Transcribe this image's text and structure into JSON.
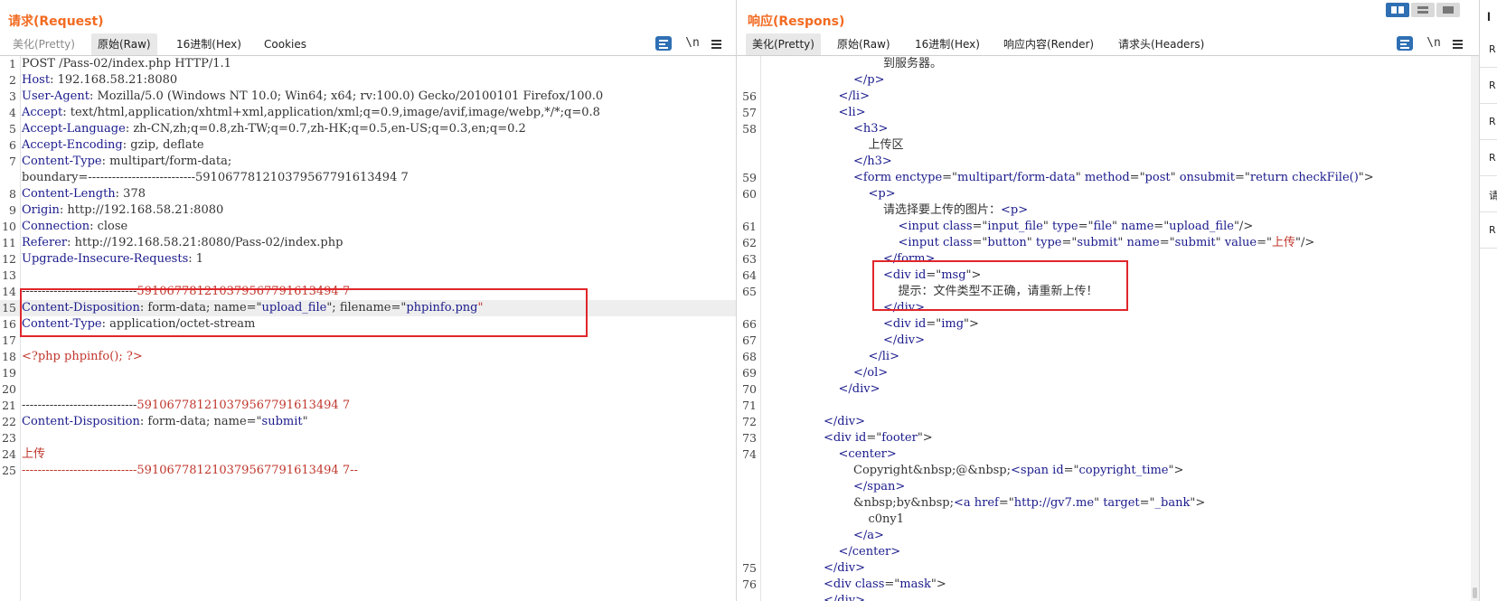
{
  "request": {
    "title": "请求(Request)",
    "tabs": [
      {
        "label": "美化(Pretty)",
        "state": "dim"
      },
      {
        "label": "原始(Raw)",
        "state": "active"
      },
      {
        "label": "16进制(Hex)",
        "state": "normal"
      },
      {
        "label": "Cookies",
        "state": "normal"
      }
    ],
    "tools": {
      "newline": "\\n"
    },
    "lines": [
      {
        "n": "1",
        "parts": [
          [
            "v",
            "POST /Pass-02/index.php HTTP/1.1"
          ]
        ]
      },
      {
        "n": "2",
        "parts": [
          [
            "k",
            "Host"
          ],
          [
            "v",
            ": 192.168.58.21:8080"
          ]
        ]
      },
      {
        "n": "3",
        "parts": [
          [
            "k",
            "User-Agent"
          ],
          [
            "v",
            ": Mozilla/5.0 (Windows NT 10.0; Win64; x64; rv:100.0) Gecko/20100101 Firefox/100.0"
          ]
        ]
      },
      {
        "n": "4",
        "parts": [
          [
            "k",
            "Accept"
          ],
          [
            "v",
            ": text/html,application/xhtml+xml,application/xml;q=0.9,image/avif,image/webp,*/*;q=0.8"
          ]
        ]
      },
      {
        "n": "5",
        "parts": [
          [
            "k",
            "Accept-Language"
          ],
          [
            "v",
            ": zh-CN,zh;q=0.8,zh-TW;q=0.7,zh-HK;q=0.5,en-US;q=0.3,en;q=0.2"
          ]
        ]
      },
      {
        "n": "6",
        "parts": [
          [
            "k",
            "Accept-Encoding"
          ],
          [
            "v",
            ": gzip, deflate"
          ]
        ]
      },
      {
        "n": "7",
        "parts": [
          [
            "k",
            "Content-Type"
          ],
          [
            "v",
            ": multipart/form-data;"
          ]
        ]
      },
      {
        "n": "",
        "parts": [
          [
            "v",
            "boundary=---------------------------591067781210379567791613494 7"
          ]
        ]
      },
      {
        "n": "8",
        "parts": [
          [
            "k",
            "Content-Length"
          ],
          [
            "v",
            ": 378"
          ]
        ]
      },
      {
        "n": "9",
        "parts": [
          [
            "k",
            "Origin"
          ],
          [
            "v",
            ": http://192.168.58.21:8080"
          ]
        ]
      },
      {
        "n": "10",
        "parts": [
          [
            "k",
            "Connection"
          ],
          [
            "v",
            ": close"
          ]
        ]
      },
      {
        "n": "11",
        "parts": [
          [
            "k",
            "Referer"
          ],
          [
            "v",
            ": http://192.168.58.21:8080/Pass-02/index.php"
          ]
        ]
      },
      {
        "n": "12",
        "parts": [
          [
            "k",
            "Upgrade-Insecure-Requests"
          ],
          [
            "v",
            ": 1"
          ]
        ]
      },
      {
        "n": "13",
        "parts": []
      },
      {
        "n": "14",
        "parts": [
          [
            "v",
            "-----------------------------"
          ],
          [
            "r",
            "591067781210379567791613494 7"
          ]
        ]
      },
      {
        "n": "15",
        "parts": [
          [
            "k",
            "Content-Disposition"
          ],
          [
            "v",
            ": form-data; name=\""
          ],
          [
            "s",
            "upload_file"
          ],
          [
            "v",
            "\"; filename=\""
          ],
          [
            "s",
            "phpinfo.png"
          ],
          [
            "r",
            "\""
          ]
        ],
        "hl": true
      },
      {
        "n": "16",
        "parts": [
          [
            "k",
            "Content-Type"
          ],
          [
            "v",
            ": application/octet-stream"
          ]
        ]
      },
      {
        "n": "17",
        "parts": []
      },
      {
        "n": "18",
        "parts": [
          [
            "r",
            "<?php phpinfo(); ?>"
          ]
        ]
      },
      {
        "n": "19",
        "parts": []
      },
      {
        "n": "20",
        "parts": []
      },
      {
        "n": "21",
        "parts": [
          [
            "v",
            "-----------------------------"
          ],
          [
            "r",
            "591067781210379567791613494 7"
          ]
        ]
      },
      {
        "n": "22",
        "parts": [
          [
            "k",
            "Content-Disposition"
          ],
          [
            "v",
            ": form-data; name=\""
          ],
          [
            "s",
            "submit"
          ],
          [
            "v",
            "\""
          ]
        ]
      },
      {
        "n": "23",
        "parts": []
      },
      {
        "n": "24",
        "parts": [
          [
            "r",
            "上传"
          ]
        ]
      },
      {
        "n": "25",
        "parts": [
          [
            "r",
            "-----------------------------591067781210379567791613494 7--"
          ]
        ]
      }
    ]
  },
  "response": {
    "title": "响应(Respons)",
    "tabs": [
      {
        "label": "美化(Pretty)",
        "state": "active"
      },
      {
        "label": "原始(Raw)",
        "state": "normal"
      },
      {
        "label": "16进制(Hex)",
        "state": "normal"
      },
      {
        "label": "响应内容(Render)",
        "state": "normal"
      },
      {
        "label": "请求头(Headers)",
        "state": "normal"
      }
    ],
    "tools": {
      "newline": "\\n"
    },
    "lines": [
      {
        "n": "",
        "i": 8,
        "parts": [
          [
            "v",
            "到服务器。"
          ]
        ]
      },
      {
        "n": "",
        "i": 6,
        "parts": [
          [
            "s",
            "</p>"
          ]
        ]
      },
      {
        "n": "56",
        "i": 5,
        "parts": [
          [
            "s",
            "</li>"
          ]
        ]
      },
      {
        "n": "57",
        "i": 5,
        "parts": [
          [
            "s",
            "<li>"
          ]
        ]
      },
      {
        "n": "58",
        "i": 6,
        "parts": [
          [
            "s",
            "<h3>"
          ]
        ]
      },
      {
        "n": "",
        "i": 7,
        "parts": [
          [
            "v",
            "上传区"
          ]
        ]
      },
      {
        "n": "",
        "i": 6,
        "parts": [
          [
            "s",
            "</h3>"
          ]
        ]
      },
      {
        "n": "59",
        "i": 6,
        "parts": [
          [
            "s",
            "<form "
          ],
          [
            "k",
            "enctype"
          ],
          [
            "v",
            "=\""
          ],
          [
            "s",
            "multipart/form-data"
          ],
          [
            "v",
            "\" "
          ],
          [
            "k",
            "method"
          ],
          [
            "v",
            "=\""
          ],
          [
            "s",
            "post"
          ],
          [
            "v",
            "\" "
          ],
          [
            "k",
            "onsubmit"
          ],
          [
            "v",
            "=\""
          ],
          [
            "s",
            "return checkFile()"
          ],
          [
            "v",
            "\">"
          ]
        ]
      },
      {
        "n": "60",
        "i": 7,
        "parts": [
          [
            "s",
            "<p>"
          ]
        ]
      },
      {
        "n": "",
        "i": 8,
        "parts": [
          [
            "v",
            "请选择要上传的图片："
          ],
          [
            "s",
            "<p>"
          ]
        ]
      },
      {
        "n": "61",
        "i": 9,
        "parts": [
          [
            "s",
            "<input "
          ],
          [
            "k",
            "class"
          ],
          [
            "v",
            "=\""
          ],
          [
            "s",
            "input_file"
          ],
          [
            "v",
            "\" "
          ],
          [
            "k",
            "type"
          ],
          [
            "v",
            "=\""
          ],
          [
            "s",
            "file"
          ],
          [
            "v",
            "\" "
          ],
          [
            "k",
            "name"
          ],
          [
            "v",
            "=\""
          ],
          [
            "s",
            "upload_file"
          ],
          [
            "v",
            "\"/>"
          ]
        ]
      },
      {
        "n": "62",
        "i": 9,
        "parts": [
          [
            "s",
            "<input "
          ],
          [
            "k",
            "class"
          ],
          [
            "v",
            "=\""
          ],
          [
            "s",
            "button"
          ],
          [
            "v",
            "\" "
          ],
          [
            "k",
            "type"
          ],
          [
            "v",
            "=\""
          ],
          [
            "s",
            "submit"
          ],
          [
            "v",
            "\" "
          ],
          [
            "k",
            "name"
          ],
          [
            "v",
            "=\""
          ],
          [
            "s",
            "submit"
          ],
          [
            "v",
            "\" "
          ],
          [
            "k",
            "value"
          ],
          [
            "v",
            "=\""
          ],
          [
            "r",
            "上传"
          ],
          [
            "v",
            "\"/>"
          ]
        ]
      },
      {
        "n": "63",
        "i": 8,
        "parts": [
          [
            "s",
            "</form>"
          ]
        ]
      },
      {
        "n": "64",
        "i": 8,
        "parts": [
          [
            "s",
            "<div "
          ],
          [
            "k",
            "id"
          ],
          [
            "v",
            "=\""
          ],
          [
            "s",
            "msg"
          ],
          [
            "v",
            "\">"
          ]
        ]
      },
      {
        "n": "65",
        "i": 9,
        "parts": [
          [
            "v",
            "提示：文件类型不正确，请重新上传！"
          ]
        ]
      },
      {
        "n": "",
        "i": 8,
        "parts": [
          [
            "s",
            "</div>"
          ]
        ]
      },
      {
        "n": "66",
        "i": 8,
        "parts": [
          [
            "s",
            "<div "
          ],
          [
            "k",
            "id"
          ],
          [
            "v",
            "=\""
          ],
          [
            "s",
            "img"
          ],
          [
            "v",
            "\">"
          ]
        ]
      },
      {
        "n": "67",
        "i": 8,
        "parts": [
          [
            "s",
            "</div>"
          ]
        ]
      },
      {
        "n": "68",
        "i": 7,
        "parts": [
          [
            "s",
            "</li>"
          ]
        ]
      },
      {
        "n": "69",
        "i": 6,
        "parts": [
          [
            "s",
            "</ol>"
          ]
        ]
      },
      {
        "n": "70",
        "i": 5,
        "parts": [
          [
            "s",
            "</div>"
          ]
        ]
      },
      {
        "n": "71",
        "i": 0,
        "parts": []
      },
      {
        "n": "72",
        "i": 4,
        "parts": [
          [
            "s",
            "</div>"
          ]
        ]
      },
      {
        "n": "73",
        "i": 4,
        "parts": [
          [
            "s",
            "<div "
          ],
          [
            "k",
            "id"
          ],
          [
            "v",
            "=\""
          ],
          [
            "s",
            "footer"
          ],
          [
            "v",
            "\">"
          ]
        ]
      },
      {
        "n": "74",
        "i": 5,
        "parts": [
          [
            "s",
            "<center>"
          ]
        ]
      },
      {
        "n": "",
        "i": 6,
        "parts": [
          [
            "v",
            "Copyright&nbsp;@&nbsp;"
          ],
          [
            "s",
            "<span "
          ],
          [
            "k",
            "id"
          ],
          [
            "v",
            "=\""
          ],
          [
            "s",
            "copyright_time"
          ],
          [
            "v",
            "\">"
          ]
        ]
      },
      {
        "n": "",
        "i": 6,
        "parts": [
          [
            "s",
            "</span>"
          ]
        ]
      },
      {
        "n": "",
        "i": 6,
        "parts": [
          [
            "v",
            "&nbsp;by&nbsp;"
          ],
          [
            "s",
            "<a "
          ],
          [
            "k",
            "href"
          ],
          [
            "v",
            "=\""
          ],
          [
            "s",
            "http://gv7.me"
          ],
          [
            "v",
            "\" "
          ],
          [
            "k",
            "target"
          ],
          [
            "v",
            "=\""
          ],
          [
            "s",
            "_bank"
          ],
          [
            "v",
            "\">"
          ]
        ]
      },
      {
        "n": "",
        "i": 7,
        "parts": [
          [
            "v",
            "c0ny1"
          ]
        ]
      },
      {
        "n": "",
        "i": 6,
        "parts": [
          [
            "s",
            "</a>"
          ]
        ]
      },
      {
        "n": "",
        "i": 5,
        "parts": [
          [
            "s",
            "</center>"
          ]
        ]
      },
      {
        "n": "75",
        "i": 4,
        "parts": [
          [
            "s",
            "</div>"
          ]
        ]
      },
      {
        "n": "76",
        "i": 4,
        "parts": [
          [
            "s",
            "<div "
          ],
          [
            "k",
            "class"
          ],
          [
            "v",
            "=\""
          ],
          [
            "s",
            "mask"
          ],
          [
            "v",
            "\">"
          ]
        ]
      },
      {
        "n": "",
        "i": 4,
        "parts": [
          [
            "s",
            "</div>"
          ]
        ]
      }
    ]
  },
  "inspector": {
    "title": "I",
    "tabs": [
      "R",
      "R",
      "R",
      "R",
      "请",
      "R"
    ]
  },
  "colors": {
    "accent": "#f26b21",
    "highlight_box": "#e0262b",
    "tag": "#1a1a8c",
    "string_red": "#c0362c"
  }
}
